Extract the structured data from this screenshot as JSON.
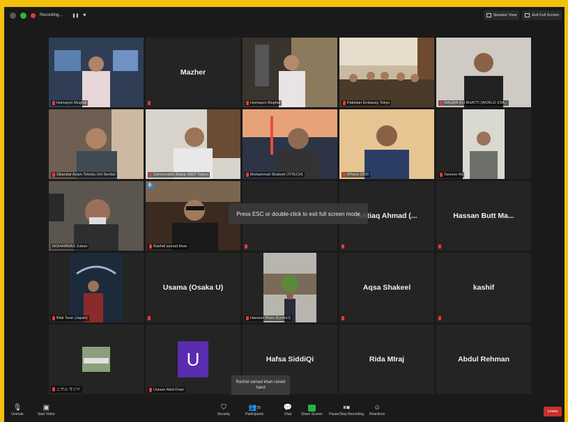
{
  "topbar": {
    "recording_label": "Recording...",
    "speaker_view_label": "Speaker View",
    "exit_full_screen_label": "Exit Full Screen"
  },
  "participants": [
    {
      "name": "Humayun Mughal",
      "type": "video"
    },
    {
      "name": "Mazher",
      "type": "name"
    },
    {
      "name": "Humayun Mughal",
      "type": "video"
    },
    {
      "name": "Pakistan Embassy Tokyo",
      "type": "video"
    },
    {
      "name": "WAQAR ALI BHATTI (WORLD STA...",
      "type": "video"
    },
    {
      "name": "Sikandar Azam Tohoku Uni Sendai",
      "type": "video"
    },
    {
      "name": "Zaheeruddin Babar (NEP Tokyo)",
      "type": "video"
    },
    {
      "name": "Muhammad Shakeel (TITECH)",
      "type": "video"
    },
    {
      "name": "iPhone 2020",
      "type": "video"
    },
    {
      "name": "Tanveer Ali",
      "type": "video"
    },
    {
      "name": "MOHAMMAD Zubair",
      "type": "video"
    },
    {
      "name": "Rashid samad khan",
      "type": "video"
    },
    {
      "name": "",
      "type": "blank"
    },
    {
      "name": "Ishtiaq Ahmad (...",
      "type": "name"
    },
    {
      "name": "Hassan Butt  Ma...",
      "type": "name"
    },
    {
      "name": "Bilal Tarar (Japan)",
      "type": "video"
    },
    {
      "name": "Usama (Osaka U)",
      "type": "name"
    },
    {
      "name": "Hassam Khan (KyotoU)",
      "type": "video"
    },
    {
      "name": "Aqsa Shakeel",
      "type": "name"
    },
    {
      "name": "kashif",
      "type": "name"
    },
    {
      "name": "ニサル サジド",
      "type": "video"
    },
    {
      "name": "Usman Abid Khan",
      "type": "avatar",
      "initial": "U"
    },
    {
      "name": "Hafsa SiddiQi",
      "type": "name"
    },
    {
      "name": "Rida MIraj",
      "type": "name"
    },
    {
      "name": "Abdul Rehman",
      "type": "name"
    }
  ],
  "toast": "Press ESC or double-click to exit full screen mode",
  "raised_hand": "Rashid samad khan raised hand",
  "toolbar": {
    "unmute": "Unmute",
    "start_video": "Start Video",
    "security": "Security",
    "participants": "Participants",
    "participants_count": "25",
    "chat": "Chat",
    "share_screen": "Share Screen",
    "pause_recording": "Pause/Stop Recording",
    "reactions": "Reactions",
    "leave": "Leave"
  },
  "colors": {
    "frame": "#f2c10e",
    "background": "#1a1a1a",
    "tile": "#242424",
    "active_border": "#b8d232",
    "leave": "#c9302c",
    "share_green": "#22b24c"
  }
}
